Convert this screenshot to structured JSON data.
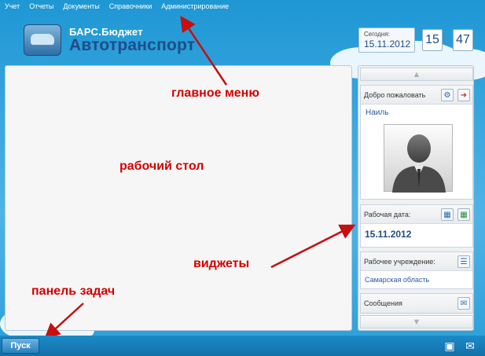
{
  "menu": [
    "Учет",
    "Отчеты",
    "Документы",
    "Справочники",
    "Администрирование"
  ],
  "logo": {
    "line1": "БАРС.Бюджет",
    "line2": "Автотранспорт"
  },
  "today": {
    "label": "Сегодня:",
    "date": "15.11.2012",
    "hours": "15",
    "minutes": "47"
  },
  "widgets": {
    "welcome": {
      "title": "Добро пожаловать",
      "user": "Наиль"
    },
    "work_date": {
      "title": "Рабочая дата:",
      "value": "15.11.2012"
    },
    "org": {
      "title": "Рабочее учреждение:",
      "value": "Самарская область"
    },
    "messages": {
      "title": "Сообщения"
    }
  },
  "annotations": {
    "main_menu": "главное меню",
    "desktop": "рабочий стол",
    "widgets": "виджеты",
    "taskbar": "панель задач"
  },
  "taskbar": {
    "start": "Пуск"
  },
  "colors": {
    "annotation": "#d40000",
    "accent": "#1f4d86",
    "background": "#2a9fd9"
  }
}
